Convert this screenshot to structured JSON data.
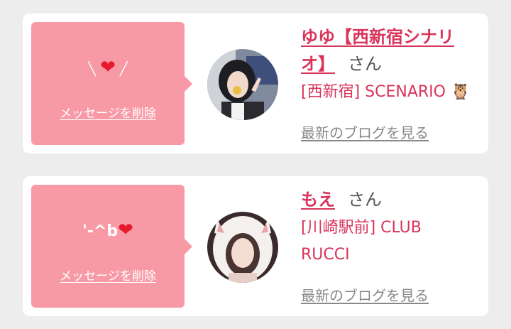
{
  "messages": [
    {
      "stamp_heart": "❤",
      "delete_label": "メッセージを削除",
      "name": "ゆゆ【西新宿シナリオ】",
      "honorific": "さん",
      "shop": "[西新宿] SCENARIO",
      "shop_icon": "🦉",
      "blog_link": "最新のブログを見る"
    },
    {
      "stamp_text": "'-^b",
      "stamp_heart": "❤",
      "delete_label": "メッセージを削除",
      "name": "もえ",
      "honorific": "さん",
      "shop": "[川崎駅前] CLUB RUCCI",
      "blog_link": "最新のブログを見る"
    }
  ],
  "colors": {
    "bubble": "#f89aa6",
    "accent": "#d9345a",
    "link_gray": "#888888",
    "background": "#ededed"
  }
}
